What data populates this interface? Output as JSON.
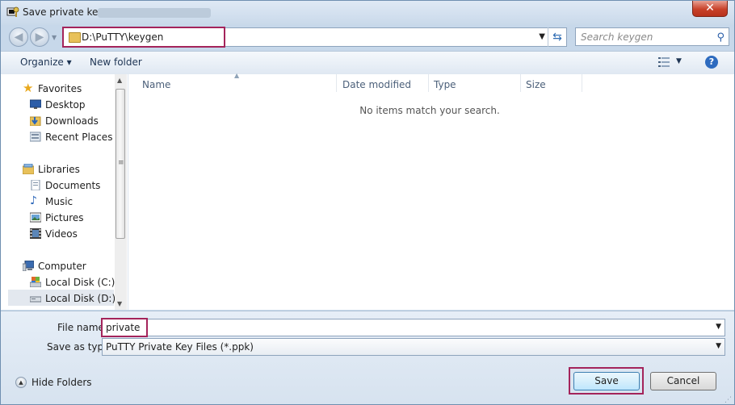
{
  "window": {
    "title": "Save private key as:",
    "close_label": "✕"
  },
  "address": {
    "path": "D:\\PuTTY\\keygen"
  },
  "search": {
    "placeholder": "Search keygen"
  },
  "toolbar": {
    "organize_label": "Organize ▾",
    "new_folder_label": "New folder"
  },
  "sidebar": {
    "items": [
      {
        "label": "Favorites",
        "icon": "star-icon"
      },
      {
        "label": "Desktop",
        "icon": "desktop-icon"
      },
      {
        "label": "Downloads",
        "icon": "downloads-icon"
      },
      {
        "label": "Recent Places",
        "icon": "recent-places-icon"
      },
      {
        "label": "Libraries",
        "icon": "libraries-icon"
      },
      {
        "label": "Documents",
        "icon": "documents-icon"
      },
      {
        "label": "Music",
        "icon": "music-icon"
      },
      {
        "label": "Pictures",
        "icon": "pictures-icon"
      },
      {
        "label": "Videos",
        "icon": "videos-icon"
      },
      {
        "label": "Computer",
        "icon": "computer-icon"
      },
      {
        "label": "Local Disk (C:)",
        "icon": "drive-c-icon"
      },
      {
        "label": "Local Disk (D:)",
        "icon": "drive-d-icon"
      }
    ]
  },
  "columns": [
    "Name",
    "Date modified",
    "Type",
    "Size"
  ],
  "empty_message": "No items match your search.",
  "form": {
    "file_name_label": "File name:",
    "file_name_value": "private",
    "save_type_label": "Save as type:",
    "save_type_value": "PuTTY Private Key Files (*.ppk)"
  },
  "footer": {
    "hide_folders_label": "Hide Folders",
    "save_label": "Save",
    "cancel_label": "Cancel"
  },
  "colors": {
    "highlight_box": "#a4245b",
    "chrome": "#c7d8ea"
  }
}
